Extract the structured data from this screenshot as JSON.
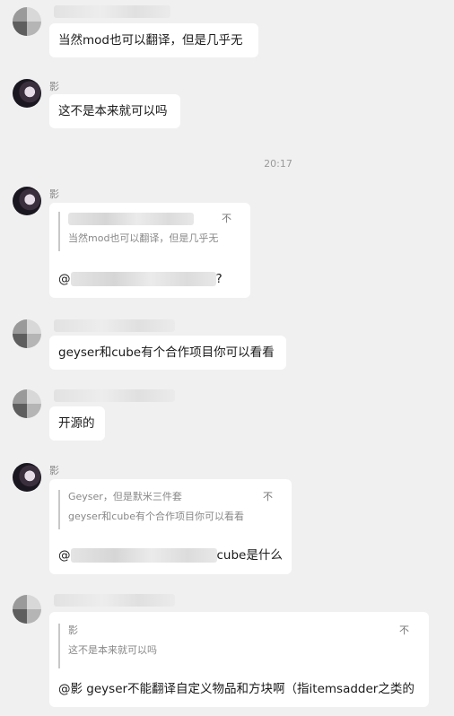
{
  "timestamp": "20:17",
  "messages": [
    {
      "text": "当然mod也可以翻译，但是几乎无"
    },
    {
      "sender": "影",
      "text": "这不是本来就可以吗"
    },
    {
      "sender": "影",
      "quote_text": "当然mod也可以翻译，但是几乎无",
      "quote_mark": "不",
      "reply_prefix": "@",
      "reply_suffix": "?"
    },
    {
      "text": "geyser和cube有个合作项目你可以看看"
    },
    {
      "text": "开源的"
    },
    {
      "sender": "影",
      "quote_author": "Geyser，但是默米三件套",
      "quote_text": "geyser和cube有个合作项目你可以看看",
      "quote_mark": "不",
      "reply_prefix": "@",
      "reply_suffix": "cube是什么"
    },
    {
      "quote_author": "影",
      "quote_text": "这不是本来就可以吗",
      "quote_mark": "不",
      "reply_text": "@影 geyser不能翻译自定义物品和方块啊（指itemsadder之类的"
    }
  ]
}
